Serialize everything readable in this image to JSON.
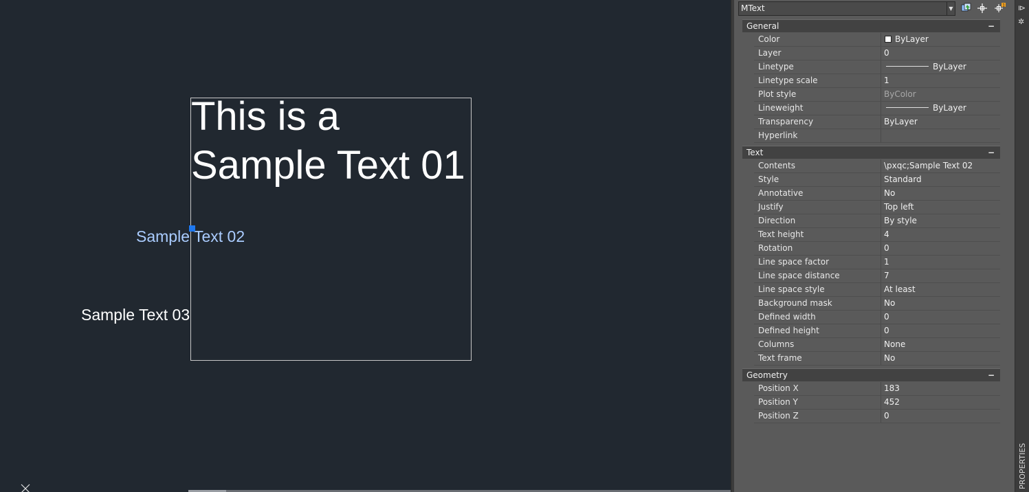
{
  "canvas": {
    "mtext_01": "This is a\nSample Text 01",
    "mtext_02": "Sample Text 02",
    "mtext_03": "Sample Text 03"
  },
  "properties": {
    "object_type": "MText",
    "palette_title": "PROPERTIES",
    "collapse_symbol": "−",
    "sections": {
      "general": {
        "title": "General",
        "rows": [
          {
            "name": "Color",
            "value": "ByLayer",
            "swatch": "#ffffff"
          },
          {
            "name": "Layer",
            "value": "0"
          },
          {
            "name": "Linetype",
            "value": "ByLayer"
          },
          {
            "name": "Linetype scale",
            "value": "1"
          },
          {
            "name": "Plot style",
            "value": "ByColor"
          },
          {
            "name": "Lineweight",
            "value": "ByLayer"
          },
          {
            "name": "Transparency",
            "value": "ByLayer"
          },
          {
            "name": "Hyperlink",
            "value": ""
          }
        ]
      },
      "text": {
        "title": "Text",
        "rows": [
          {
            "name": "Contents",
            "value": "\\pxqc;Sample Text 02"
          },
          {
            "name": "Style",
            "value": "Standard"
          },
          {
            "name": "Annotative",
            "value": "No"
          },
          {
            "name": "Justify",
            "value": "Top left"
          },
          {
            "name": "Direction",
            "value": "By style"
          },
          {
            "name": "Text height",
            "value": "4"
          },
          {
            "name": "Rotation",
            "value": "0"
          },
          {
            "name": "Line space factor",
            "value": "1"
          },
          {
            "name": "Line space distance",
            "value": "7"
          },
          {
            "name": "Line space style",
            "value": "At least"
          },
          {
            "name": "Background mask",
            "value": "No"
          },
          {
            "name": "Defined width",
            "value": "0"
          },
          {
            "name": "Defined height",
            "value": "0"
          },
          {
            "name": "Columns",
            "value": "None"
          },
          {
            "name": "Text frame",
            "value": "No"
          }
        ]
      },
      "geometry": {
        "title": "Geometry",
        "rows": [
          {
            "name": "Position X",
            "value": "183"
          },
          {
            "name": "Position Y",
            "value": "452"
          },
          {
            "name": "Position Z",
            "value": "0"
          }
        ]
      }
    }
  },
  "colors": {
    "canvas_bg": "#212830",
    "selected_text": "#aaccff",
    "grip": "#1e78f0",
    "palette_bg": "#5a5a5a"
  }
}
